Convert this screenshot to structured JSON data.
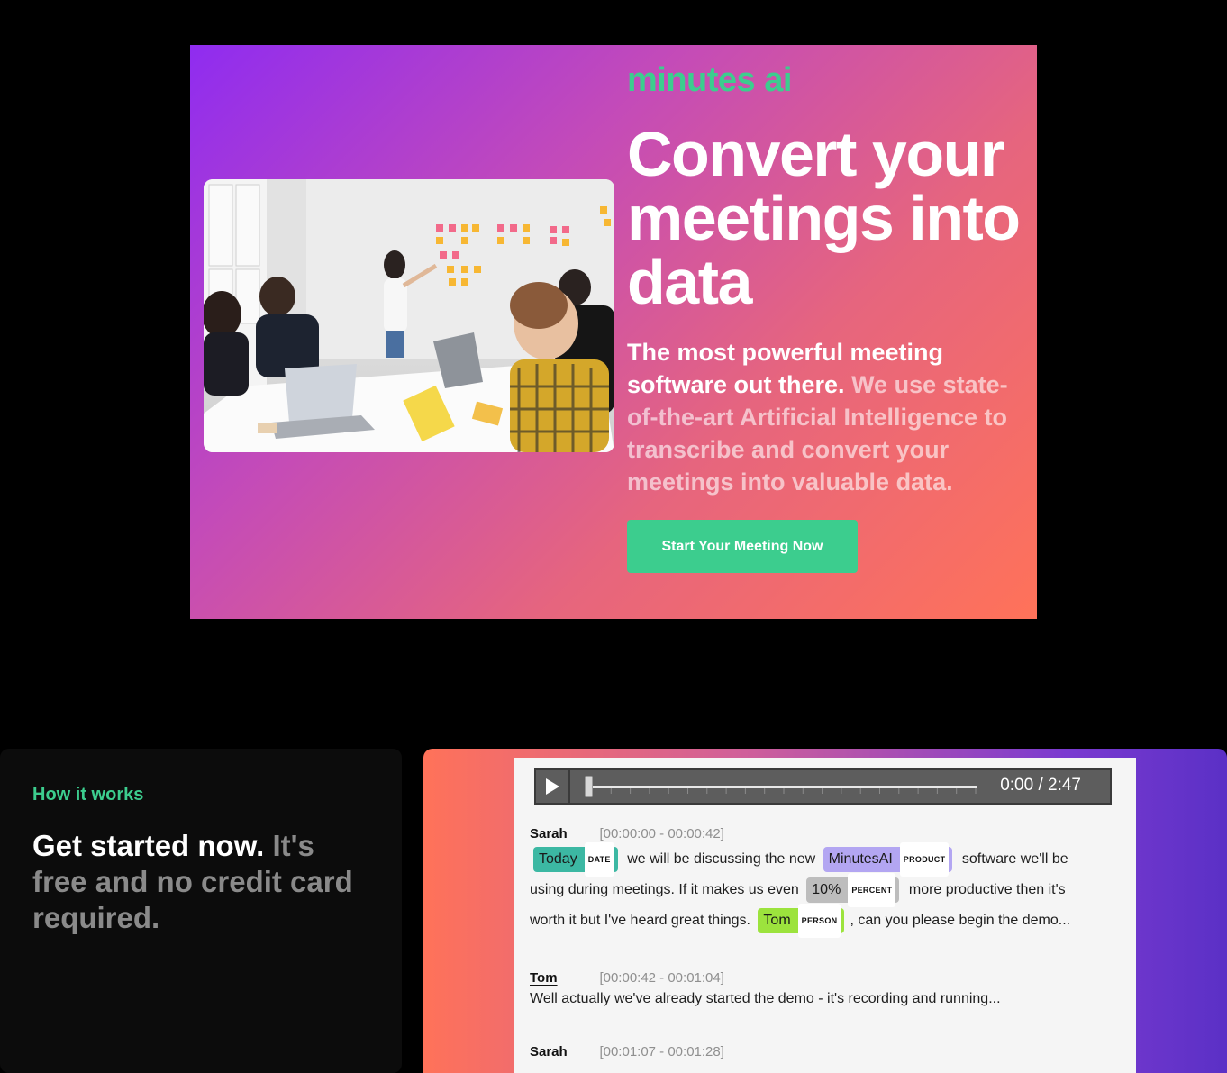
{
  "hero": {
    "brand": "minutes ai",
    "headline": "Convert your meetings into data",
    "sub_bold": "The most powerful meeting software out there.",
    "sub_muted": "We use state-of-the-art Artificial Intelligence to transcribe and convert your meetings into valuable data.",
    "cta_label": "Start Your Meeting Now"
  },
  "how": {
    "label": "How it works",
    "title_bold": "Get started now.",
    "title_muted": "It's free and no credit card required."
  },
  "player": {
    "time": "0:00 / 2:47",
    "progress": 0
  },
  "transcript": [
    {
      "speaker": "Sarah",
      "timestamp": "[00:00:00 - 00:00:42]",
      "line1_text_a": "we will be discussing the new",
      "line1_text_b": "software we'll be",
      "line2_text_a": "using during meetings. If it makes us even",
      "line2_text_b": "more productive then it's",
      "line3_text_a": "worth it but I've heard great things.",
      "line3_text_b": ", can you please begin the demo...",
      "entities": {
        "date": {
          "text": "Today",
          "tag": "DATE",
          "color": "#3cb8a3"
        },
        "product": {
          "text": "MinutesAI",
          "tag": "PRODUCT",
          "color": "#b3a6f2"
        },
        "percent": {
          "text": "10%",
          "tag": "PERCENT",
          "color": "#bdbdbd"
        },
        "person": {
          "text": "Tom",
          "tag": "PERSON",
          "color": "#9ce33d"
        }
      }
    },
    {
      "speaker": "Tom",
      "timestamp": "[00:00:42 - 00:01:04]",
      "text": "Well actually we've already started the demo - it's recording and running..."
    },
    {
      "speaker": "Sarah",
      "timestamp": "[00:01:07 - 00:01:28]"
    }
  ],
  "colors": {
    "accent": "#3ccd8e",
    "hero_gradient_start": "#8f2cf0",
    "hero_gradient_end": "#ff7259"
  }
}
